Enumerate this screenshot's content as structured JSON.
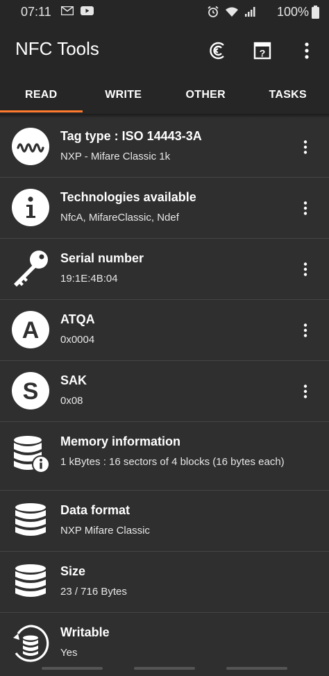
{
  "status_bar": {
    "time": "07:11",
    "battery": "100%"
  },
  "app": {
    "title": "NFC Tools"
  },
  "toolbar": {
    "icons": [
      "refresh-icon",
      "help-icon",
      "more-vert-icon"
    ]
  },
  "tabs": [
    {
      "label": "READ",
      "active": true
    },
    {
      "label": "WRITE",
      "active": false
    },
    {
      "label": "OTHER",
      "active": false
    },
    {
      "label": "TASKS",
      "active": false
    }
  ],
  "accent_color": "#ff7a2e",
  "items": [
    {
      "title": "Tag type : ISO 14443-3A",
      "subtitle": "NXP - Mifare Classic 1k",
      "icon": "wave-icon",
      "has_menu": true
    },
    {
      "title": "Technologies available",
      "subtitle": "NfcA, MifareClassic, Ndef",
      "icon": "info-icon",
      "has_menu": true
    },
    {
      "title": "Serial number",
      "subtitle": "19:1E:4B:04",
      "icon": "key-icon",
      "has_menu": true
    },
    {
      "title": "ATQA",
      "subtitle": "0x0004",
      "icon": "letter-a-icon",
      "has_menu": true
    },
    {
      "title": "SAK",
      "subtitle": "0x08",
      "icon": "letter-s-icon",
      "has_menu": true
    },
    {
      "title": "Memory information",
      "subtitle": "1 kBytes : 16 sectors of 4 blocks (16 bytes each)",
      "icon": "database-info-icon",
      "has_menu": false
    },
    {
      "title": "Data format",
      "subtitle": "NXP Mifare Classic",
      "icon": "database-icon",
      "has_menu": false
    },
    {
      "title": "Size",
      "subtitle": "23 / 716 Bytes",
      "icon": "database-stack-icon",
      "has_menu": false
    },
    {
      "title": "Writable",
      "subtitle": "Yes",
      "icon": "database-refresh-icon",
      "has_menu": false
    }
  ]
}
